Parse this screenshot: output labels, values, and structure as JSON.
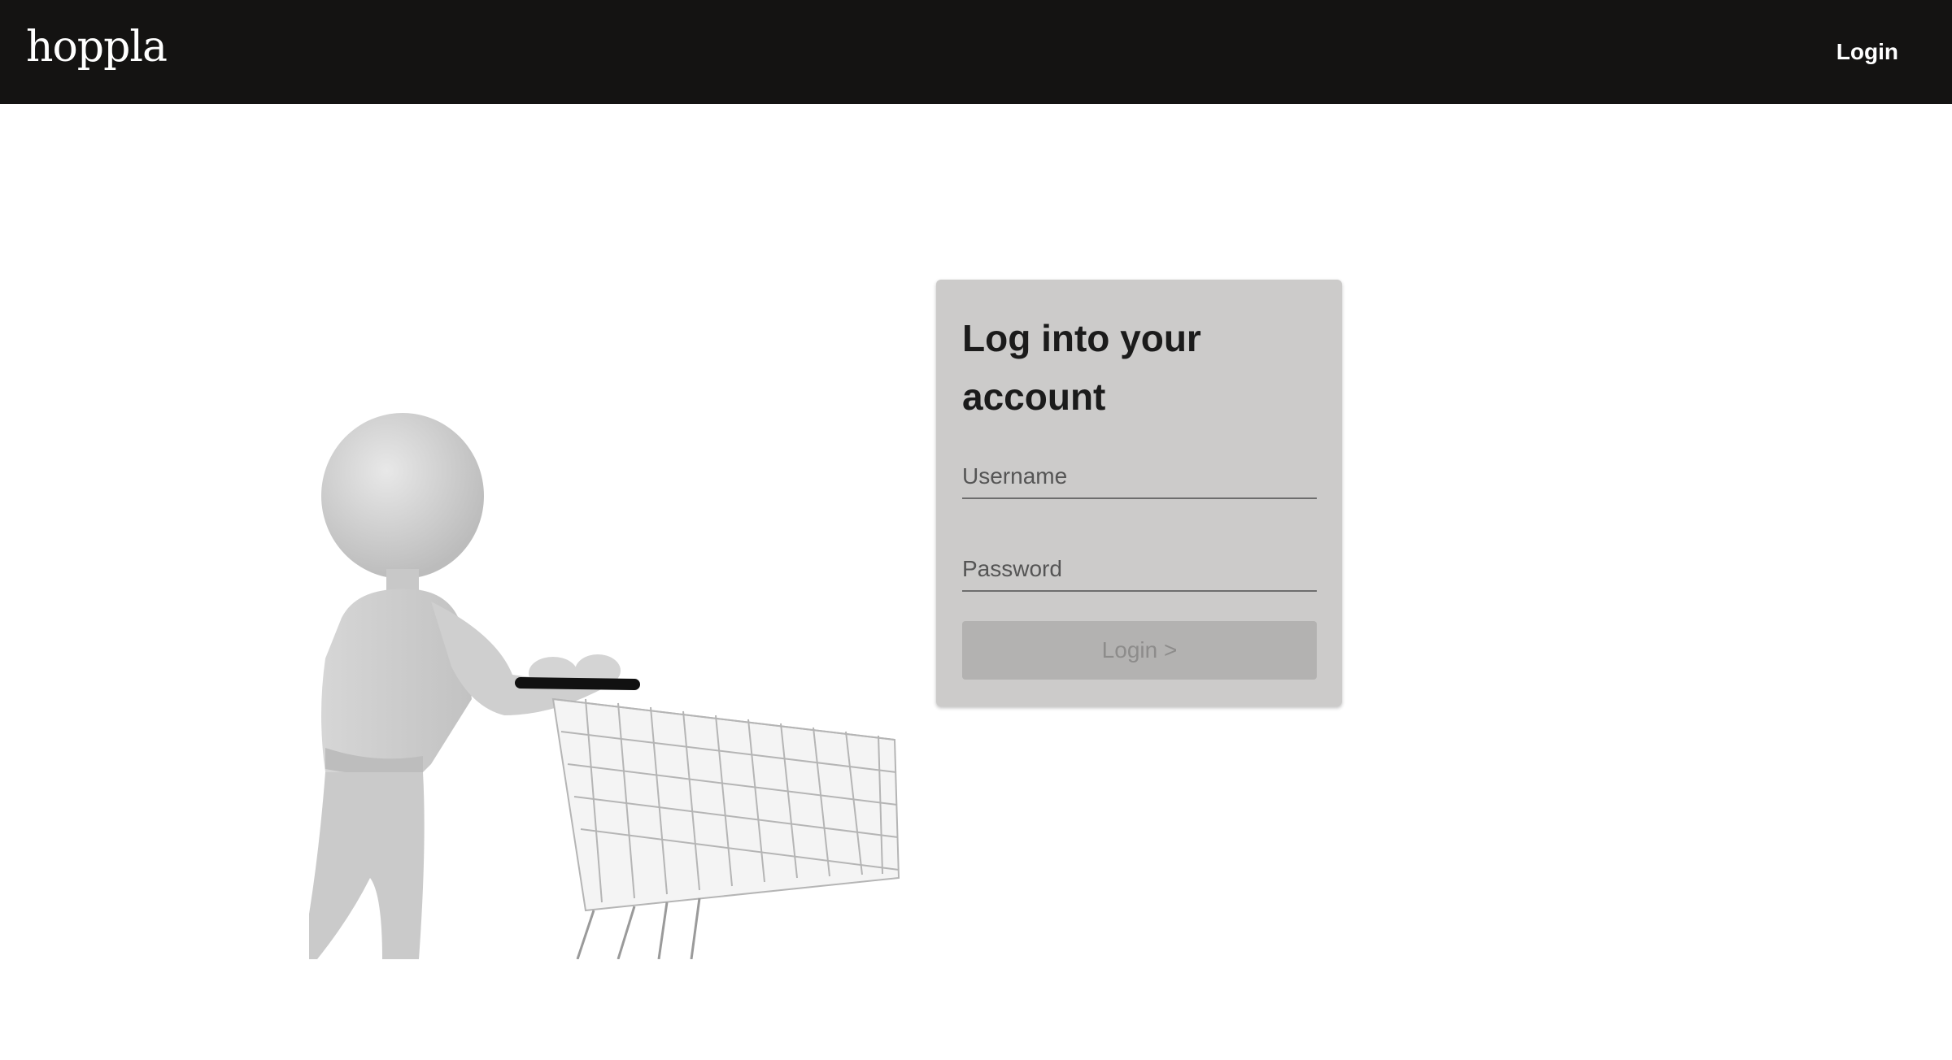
{
  "header": {
    "logo_text": "hoppla",
    "login_label": "Login"
  },
  "login_card": {
    "title": "Log into your account",
    "username_placeholder": "Username",
    "username_value": "",
    "password_placeholder": "Password",
    "password_value": "",
    "submit_label": "Login >"
  },
  "hero": {
    "description_icon": "person-pushing-shopping-cart-illustration"
  },
  "colors": {
    "header_bg": "#141312",
    "card_bg": "#cccbca",
    "button_bg": "#b3b2b1",
    "button_text": "#8d8c8b"
  }
}
